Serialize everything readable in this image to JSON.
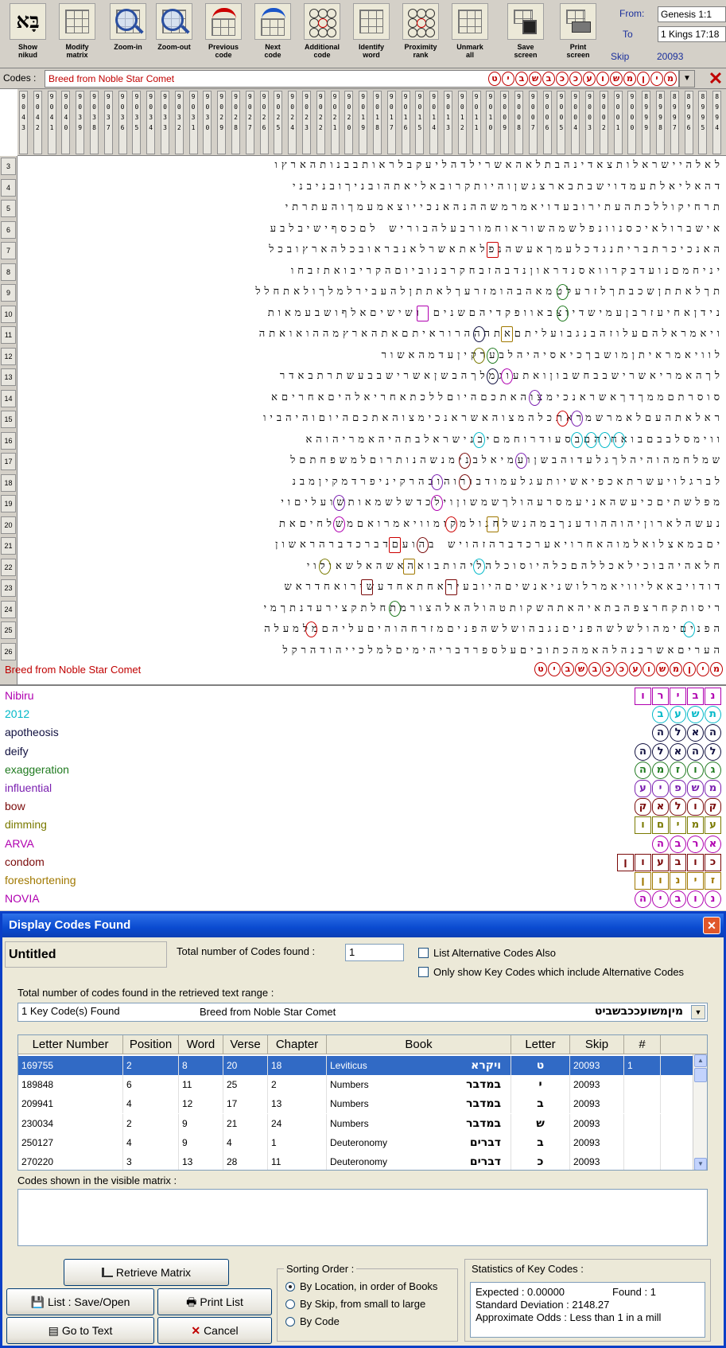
{
  "toolbar": {
    "buttons": [
      {
        "label": "Show\nnikud",
        "icon": "hebrew-letters-icon"
      },
      {
        "label": "Modify\nmatrix",
        "icon": "modify-matrix-icon"
      },
      {
        "label": "Zoom-in",
        "icon": "zoom-in-icon"
      },
      {
        "label": "Zoom-out",
        "icon": "zoom-out-icon"
      },
      {
        "label": "Previous\ncode",
        "icon": "previous-code-icon"
      },
      {
        "label": "Next\ncode",
        "icon": "next-code-icon"
      },
      {
        "label": "Additional\ncode",
        "icon": "additional-code-icon"
      },
      {
        "label": "Identify\nword",
        "icon": "identify-word-icon"
      },
      {
        "label": "Proximity\nrank",
        "icon": "proximity-rank-icon"
      },
      {
        "label": "Unmark\nall",
        "icon": "unmark-all-icon"
      },
      {
        "label": "Save\nscreen",
        "icon": "save-screen-icon"
      },
      {
        "label": "Print\nscreen",
        "icon": "print-screen-icon"
      }
    ],
    "show_nikud_glyph": "בָּא",
    "from_label": "From:",
    "from_value": "Genesis 1:1",
    "to_label": "To",
    "to_value": "1 Kings 17:18",
    "skip_label": "Skip",
    "skip_value": "20093"
  },
  "codes": {
    "label": "Codes :",
    "value": "Breed from Noble Star Comet",
    "letters": [
      "מ",
      "י",
      "ן",
      "מ",
      "ש",
      "ו",
      "ע",
      "כ",
      "כ",
      "ב",
      "ש",
      "ב",
      "י",
      "ט"
    ]
  },
  "matrix": {
    "col_numbers": [
      "9\n0\n4\n3",
      "9\n0\n4\n2",
      "9\n0\n4\n1",
      "9\n0\n4\n0",
      "9\n0\n3\n9",
      "9\n0\n3\n8",
      "9\n0\n3\n7",
      "9\n0\n3\n6",
      "9\n0\n3\n5",
      "9\n0\n3\n4",
      "9\n0\n3\n3",
      "9\n0\n3\n2",
      "9\n0\n3\n1",
      "9\n0\n3\n0",
      "9\n0\n2\n9",
      "9\n0\n2\n8",
      "9\n0\n2\n7",
      "9\n0\n2\n6",
      "9\n0\n2\n5",
      "9\n0\n2\n4",
      "9\n0\n2\n3",
      "9\n0\n2\n2",
      "9\n0\n2\n1",
      "9\n0\n2\n0",
      "9\n0\n1\n9",
      "9\n0\n1\n8",
      "9\n0\n1\n7",
      "9\n0\n1\n6",
      "9\n0\n1\n5",
      "9\n0\n1\n4",
      "9\n0\n1\n3",
      "9\n0\n1\n2",
      "9\n0\n1\n1",
      "9\n0\n1\n0",
      "9\n0\n0\n9",
      "9\n0\n0\n8",
      "9\n0\n0\n7",
      "9\n0\n0\n6",
      "9\n0\n0\n5",
      "9\n0\n0\n4",
      "9\n0\n0\n3",
      "9\n0\n0\n2",
      "9\n0\n0\n1",
      "9\n0\n0\n0",
      "8\n9\n9\n9",
      "8\n9\n9\n8",
      "8\n9\n9\n7",
      "8\n9\n9\n6",
      "8\n9\n9\n5",
      "8\n9\n9\n4"
    ],
    "rows": [
      {
        "n": "3",
        "text": "לאלהיישראלותצאדינהבתלאהאשרילדהליעקבלראותבבנותהארץו"
      },
      {
        "n": "4",
        "text": "דהאליאלתעמדוישבתבארצגשןוהיותקרובאליאתהובניךובניבני"
      },
      {
        "n": "5",
        "text": "תרחיקוללכתהעתירובעדויאמרמשההנהאנכייוצאמעמךוהעתרתי"
      },
      {
        "n": "6",
        "text": "אישברולאיכסנוונפלשמהשוראוחמורבעלהבוריש לםכסףישיבלבע"
      },
      {
        "n": "7",
        "text": "האנכיכרתבריתנגדכלעמךאעשהנפלאתאשרלאנבראובכלהארץובכל"
      },
      {
        "n": "8",
        "text": "יניחמםנועדבקרוואסנדראוןנדבהזבחקרבנוביוםהקריבואתזבחו"
      },
      {
        "n": "9",
        "text": "תךלאתתןשכבתךלזרעלטמאהבהומזרעךלאתתןלהעבירלמלךולאתחלל"
      },
      {
        "n": "10",
        "text": "נידןאחיעזרבןעמישדיוצבאוופקדיהםשנים ושישיםאלףושבעמאות"
      },
      {
        "n": "11",
        "text": "ויאמראלהםעלוזהבנגבועליתםאתהההרוראיתםאתהארץמההואואתה"
      },
      {
        "n": "12",
        "text": "לוויאמראיתןמושבךכיאסיהיהלבערקיןעדמהאשור"
      },
      {
        "n": "13",
        "text": "לךהאמריאשרישבבחשבוןואתעוגמלךהבשןאשרישבבעשתרתבאדר"
      },
      {
        "n": "14",
        "text": "סוסרתםממךדךאשראנכימצוהאתכםהיוםללכתאחריאלהיםאחריםא"
      },
      {
        "n": "15",
        "text": "ראלאתהעםלאמרשמראתכלהמצוהאשראנכימצוהאתכםהיוםוהיהביו"
      },
      {
        "n": "16",
        "text": "ווימסלבבםבואחיהםבסעודרוחמםיבנישראלבתהיהאמריהוהא"
      },
      {
        "n": "17",
        "text": "שמלחמהוהיהלךגלעדוהבשןועמיאלבנימנשהנותרוםלמשפחתםל"
      },
      {
        "n": "18",
        "text": "לברגלויעשרתאכפיאשיותעגלעמודבורוהובהרקיניפרדמקיןמבנ"
      },
      {
        "n": "19",
        "text": "מפלשתיםכיעשהאניעמסרעהולךשמשוןוילכדשלשמאותשועליםוי"
      },
      {
        "n": "20",
        "text": "נעשהלארוןיהוההודענךבמהנשלחנולמקומוויאמרואםמשלחיםאת"
      },
      {
        "n": "21",
        "text": "יםבמאצלואלמוהאחרויאערכדברהזהויש בהועםדברכדברהראשון"
      },
      {
        "n": "22",
        "text": "חלאהיהבוכילאכללהםכלהיוסוכלהליהותבואהאשהאלשאולוי"
      },
      {
        "n": "23",
        "text": "דודויבאאליוויאמרלושניאנשיםהיובעיראחתאחדעשירואחדראש"
      },
      {
        "n": "24",
        "text": "ריסותקחרצפהבתאיהאתהשקותטהולהאלהצורמתחלתקצירעדנתךמי"
      },
      {
        "n": "25",
        "text": "הפניםימהולשלשהפניםנגבהושלשהפניםמזרחהוהיםעליהםמלמעלה"
      },
      {
        "n": "26",
        "text": "העריםאשרבנהלהאמהכתוביםעלספרדבריהימיםלמלכייהודהרקל"
      }
    ],
    "footer_label": "Breed from Noble Star Comet"
  },
  "legend": [
    {
      "name": "Nibiru",
      "color": "#b000b0",
      "letters": [
        "נ",
        "ב",
        "י",
        "ר",
        "ו"
      ],
      "shape": "sq"
    },
    {
      "name": "2012",
      "color": "#00b8c8",
      "letters": [
        "ת",
        "ש",
        "ע",
        "ב"
      ],
      "shape": "round"
    },
    {
      "name": "apotheosis",
      "color": "#101040",
      "letters": [
        "ה",
        "א",
        "ל",
        "ה"
      ],
      "shape": "round"
    },
    {
      "name": "deify",
      "color": "#101040",
      "letters": [
        "ל",
        "ה",
        "א",
        "ל",
        "ה"
      ],
      "shape": "round"
    },
    {
      "name": "exaggeration",
      "color": "#1f7a1f",
      "letters": [
        "ג",
        "ו",
        "ז",
        "מ",
        "ה"
      ],
      "shape": "round"
    },
    {
      "name": "influential",
      "color": "#7a1fb0",
      "letters": [
        "מ",
        "ש",
        "פ",
        "י",
        "ע"
      ],
      "shape": "dia"
    },
    {
      "name": "bow",
      "color": "#7a0a0a",
      "letters": [
        "ק",
        "ו",
        "ל",
        "א",
        "ק"
      ],
      "shape": "dia"
    },
    {
      "name": "dimming",
      "color": "#7a7a00",
      "letters": [
        "ע",
        "מ",
        "י",
        "ם",
        "ו"
      ],
      "shape": "sq"
    },
    {
      "name": "ARVA",
      "color": "#b000b0",
      "letters": [
        "א",
        "ר",
        "ב",
        "ה"
      ],
      "shape": "round"
    },
    {
      "name": "condom",
      "color": "#7a0a0a",
      "letters": [
        "כ",
        "ו",
        "ב",
        "ע",
        "ו",
        "ן"
      ],
      "shape": "sq"
    },
    {
      "name": "foreshortening",
      "color": "#a07800",
      "letters": [
        "ז",
        "י",
        "נ",
        "ו",
        "ן"
      ],
      "shape": "sq"
    },
    {
      "name": "NOVIA",
      "color": "#b000b0",
      "letters": [
        "נ",
        "ו",
        "ב",
        "י",
        "ה"
      ],
      "shape": "round"
    }
  ],
  "dialog": {
    "title": "Display Codes Found",
    "name": "Untitled",
    "total_label": "Total number of Codes found :",
    "total_value": "1",
    "check_alt": "List Alternative Codes Also",
    "check_key": "Only show Key Codes which include Alternative Codes",
    "range_label": "Total number of codes found in the retrieved text range  :",
    "found_summary": "1 Key Code(s) Found",
    "found_name": "Breed from Noble Star Comet",
    "found_hebrew": "מיןמשועככבשביט",
    "columns": [
      "Letter Number",
      "Position",
      "Word",
      "Verse",
      "Chapter",
      "Book",
      "Letter",
      "Skip",
      "#"
    ],
    "rows": [
      {
        "letter_number": "169755",
        "position": "2",
        "word": "8",
        "verse": "20",
        "chapter": "18",
        "book": "Leviticus",
        "book_heb": "ויקרא",
        "letter": "ט",
        "skip": "20093",
        "num": "1"
      },
      {
        "letter_number": "189848",
        "position": "6",
        "word": "11",
        "verse": "25",
        "chapter": "2",
        "book": "Numbers",
        "book_heb": "במדבר",
        "letter": "י",
        "skip": "20093",
        "num": ""
      },
      {
        "letter_number": "209941",
        "position": "4",
        "word": "12",
        "verse": "17",
        "chapter": "13",
        "book": "Numbers",
        "book_heb": "במדבר",
        "letter": "ב",
        "skip": "20093",
        "num": ""
      },
      {
        "letter_number": "230034",
        "position": "2",
        "word": "9",
        "verse": "21",
        "chapter": "24",
        "book": "Numbers",
        "book_heb": "במדבר",
        "letter": "ש",
        "skip": "20093",
        "num": ""
      },
      {
        "letter_number": "250127",
        "position": "4",
        "word": "9",
        "verse": "4",
        "chapter": "1",
        "book": "Deuteronomy",
        "book_heb": "דברים",
        "letter": "ב",
        "skip": "20093",
        "num": ""
      },
      {
        "letter_number": "270220",
        "position": "3",
        "word": "13",
        "verse": "28",
        "chapter": "11",
        "book": "Deuteronomy",
        "book_heb": "דברים",
        "letter": "כ",
        "skip": "20093",
        "num": ""
      }
    ],
    "visible_label": "Codes shown in the visible matrix :",
    "btn_retrieve": "Retrieve Matrix",
    "btn_list": "List : Save/Open",
    "btn_print": "Print List",
    "btn_goto": "Go to Text",
    "btn_cancel": "Cancel",
    "sort_title": "Sorting Order :",
    "sort_options": [
      "By Location, in order of Books",
      "By Skip, from small to large",
      "By Code"
    ],
    "stats_title": "Statistics of Key Codes :",
    "stats_expected": "Expected :   0.00000",
    "stats_found": "Found : 1",
    "stats_sd": "Standard Deviation :  2148.27",
    "stats_odds": "Approximate Odds : Less than 1 in a mill"
  }
}
